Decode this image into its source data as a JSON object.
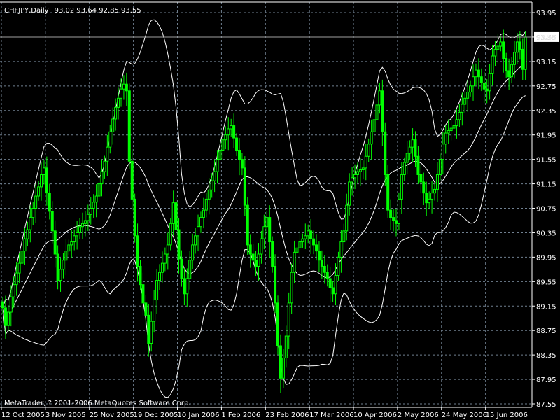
{
  "header": {
    "symbol_timeframe": "CHFJPY,Daily",
    "ohlc_text": "93.02 93.64 92.85 93.55"
  },
  "copyright": "MetaTrader, ? 2001-2006 MetaQuotes Software Corp.",
  "colors": {
    "background": "#000000",
    "candles": "#00ff00",
    "bands": "#ffffff",
    "grid": "#708090",
    "axis": "#ffffff"
  },
  "chart_data": {
    "type": "candlestick",
    "symbol": "CHFJPY",
    "timeframe": "Daily",
    "current_price": "93.55",
    "last_bar": {
      "open": 93.02,
      "high": 93.64,
      "low": 92.85,
      "close": 93.55
    },
    "ylim": [
      87.55,
      93.95
    ],
    "y_ticks": [
      "93.95",
      "93.55",
      "93.15",
      "92.75",
      "92.35",
      "91.95",
      "91.55",
      "91.15",
      "90.75",
      "90.35",
      "89.95",
      "89.55",
      "89.15",
      "88.75",
      "88.35",
      "87.95",
      "87.55"
    ],
    "x_ticks": [
      "12 Oct 2005",
      "3 Nov 2005",
      "25 Nov 2005",
      "19 Dec 2005",
      "10 Jan 2006",
      "1 Feb 2006",
      "23 Feb 2006",
      "17 Mar 2006",
      "10 Apr 2006",
      "2 May 2006",
      "24 May 2006",
      "15 Jun 2006"
    ],
    "grid": true,
    "indicator": "Bollinger Bands",
    "closes": [
      89.12,
      88.83,
      89.05,
      89.3,
      89.5,
      89.69,
      89.85,
      90.05,
      90.25,
      90.4,
      90.6,
      90.75,
      90.95,
      91.1,
      91.3,
      91.41,
      91.0,
      90.7,
      90.38,
      90.0,
      89.57,
      89.75,
      89.9,
      90.05,
      90.15,
      90.2,
      90.3,
      90.35,
      90.45,
      90.5,
      90.55,
      90.65,
      90.75,
      90.85,
      90.95,
      91.15,
      91.35,
      91.52,
      91.75,
      92.0,
      92.21,
      92.4,
      92.55,
      92.7,
      92.78,
      92.67,
      91.52,
      90.9,
      90.3,
      89.8,
      89.5,
      89.2,
      89.0,
      88.54,
      88.9,
      89.25,
      89.57,
      89.7,
      89.85,
      90.0,
      90.15,
      90.5,
      90.84,
      90.4,
      89.92,
      89.6,
      89.35,
      89.6,
      89.9,
      90.15,
      90.3,
      90.45,
      90.6,
      90.72,
      90.9,
      91.05,
      91.2,
      91.35,
      91.55,
      91.7,
      91.87,
      91.95,
      92.05,
      92.1,
      91.9,
      91.7,
      91.55,
      91.41,
      90.8,
      90.15,
      90.0,
      89.9,
      89.8,
      90.0,
      90.25,
      90.45,
      90.6,
      90.2,
      89.8,
      89.2,
      88.5,
      87.97,
      88.3,
      88.66,
      89.2,
      89.7,
      90.03,
      90.1,
      90.2,
      90.25,
      90.3,
      90.38,
      90.25,
      90.15,
      90.05,
      89.9,
      89.8,
      89.7,
      89.6,
      89.45,
      89.35,
      89.65,
      89.95,
      90.2,
      90.38,
      90.8,
      91.18,
      91.25,
      91.3,
      91.35,
      91.38,
      91.41,
      91.6,
      91.8,
      92.0,
      92.2,
      92.44,
      92.67,
      92.0,
      91.3,
      90.72,
      90.6,
      90.55,
      90.5,
      90.9,
      91.3,
      91.5,
      91.65,
      91.75,
      91.87,
      91.6,
      91.3,
      91.18,
      91.0,
      90.84,
      90.9,
      91.0,
      91.06,
      91.3,
      91.55,
      91.8,
      91.98,
      92.02,
      92.06,
      92.1,
      92.2,
      92.32,
      92.45,
      92.55,
      92.65,
      92.75,
      92.9,
      93.01,
      92.9,
      92.8,
      92.7,
      92.67,
      92.95,
      93.24,
      93.35,
      93.4,
      93.47,
      93.2,
      93.0,
      92.9,
      93.1,
      93.3,
      93.47,
      93.35,
      93.02,
      93.55
    ]
  }
}
